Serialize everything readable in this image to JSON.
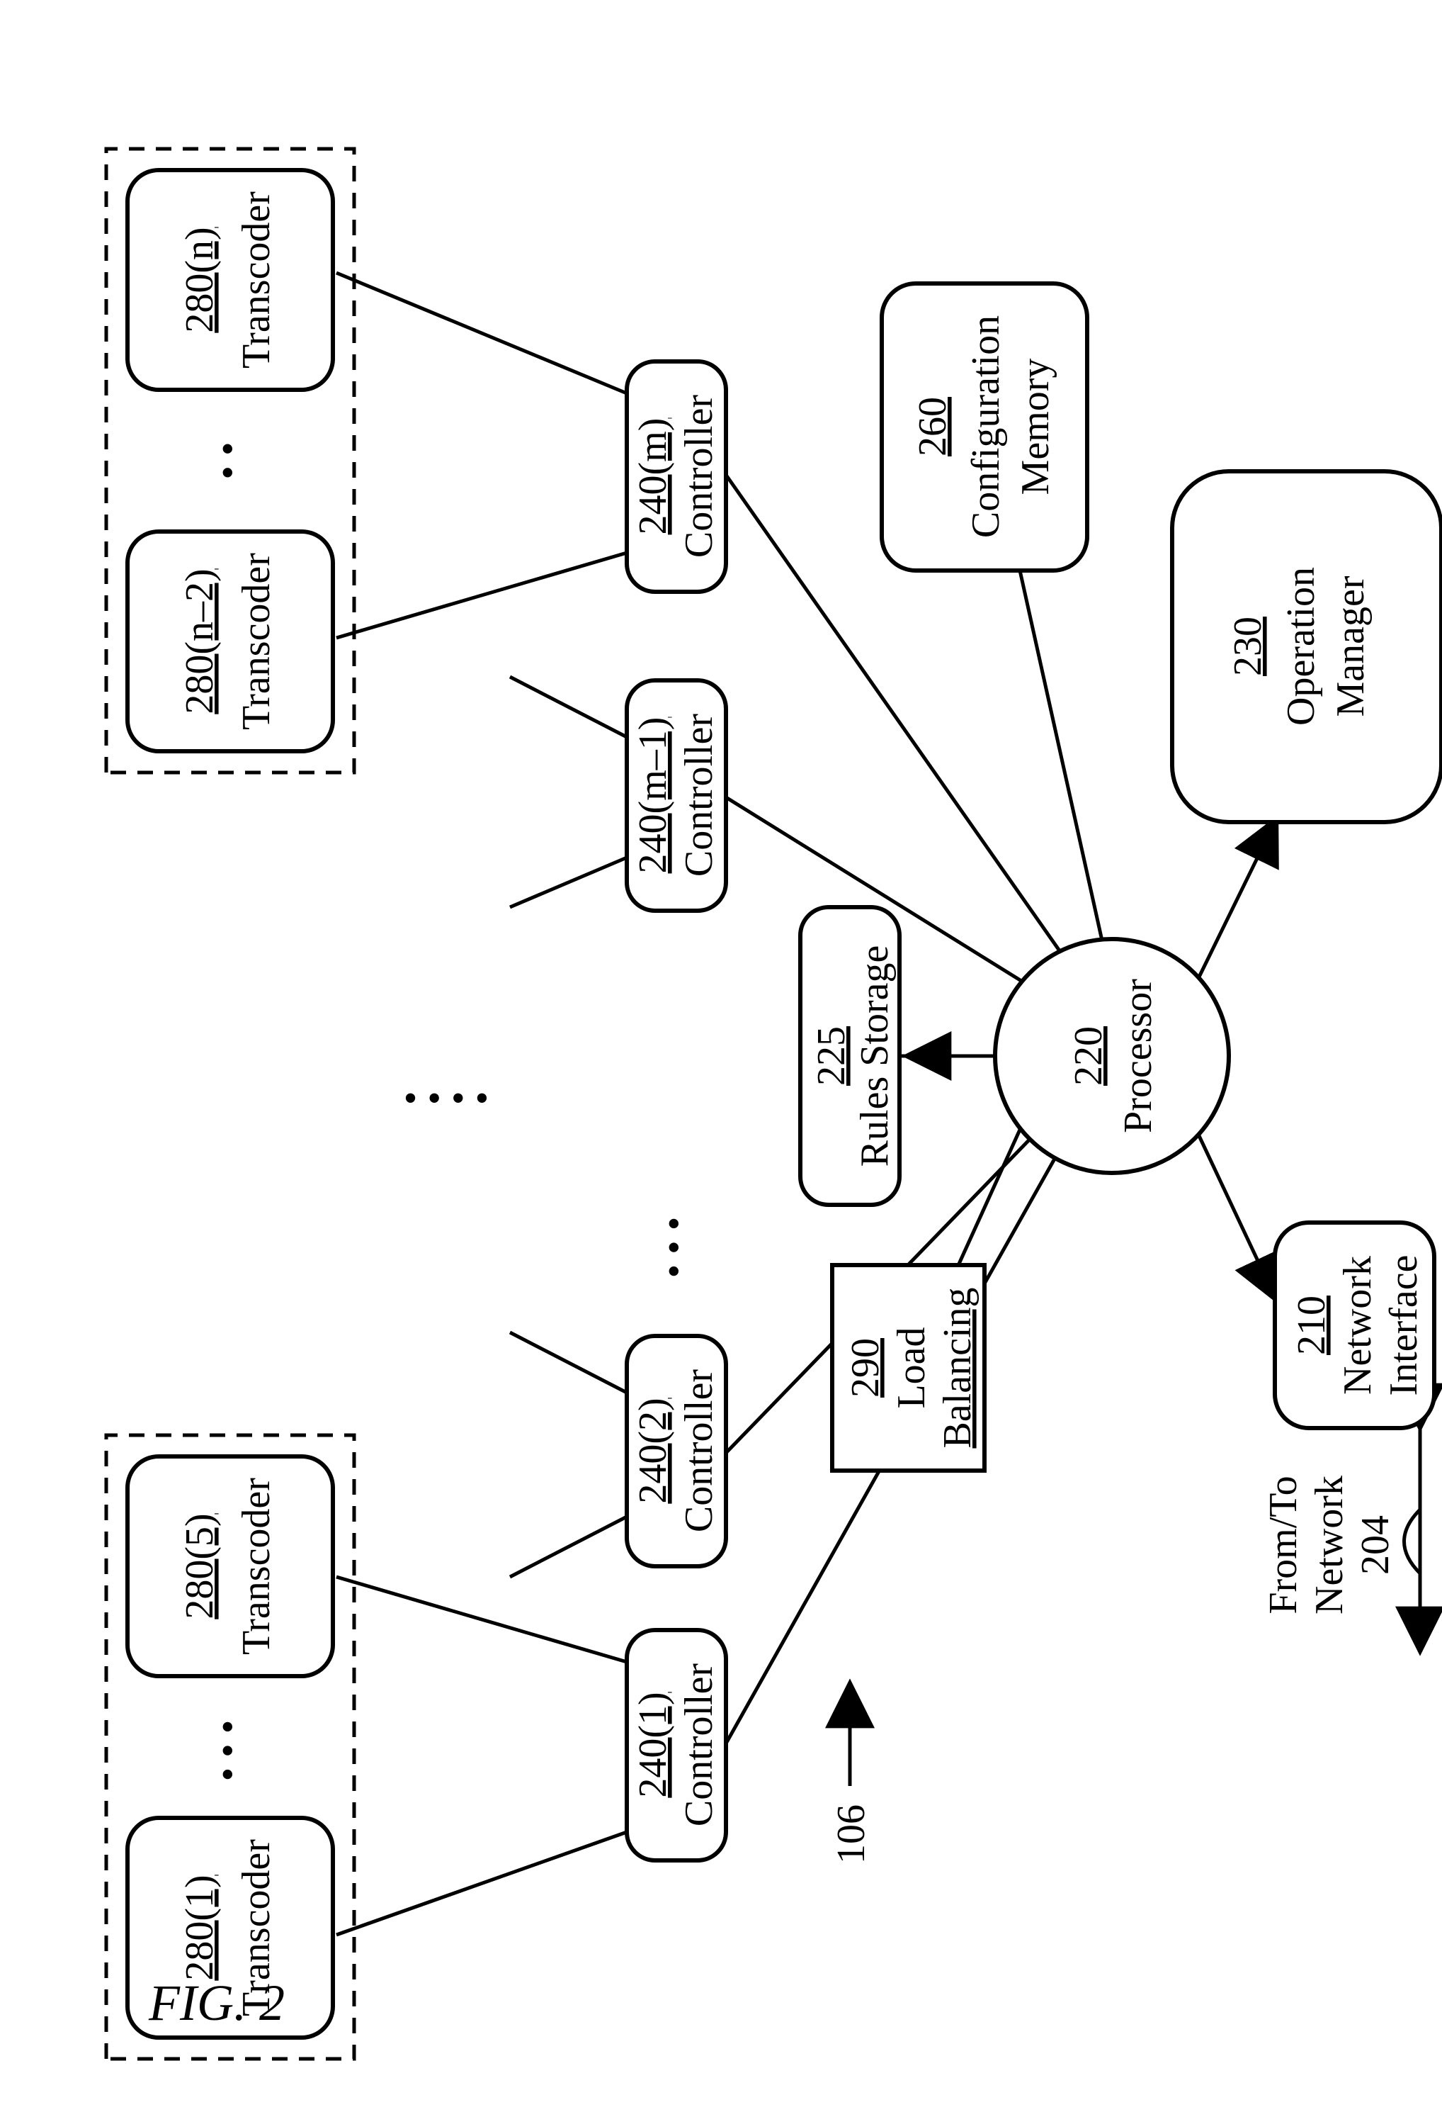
{
  "figure_label": "FIG. 2",
  "system_ref": "106",
  "network_label_1": "From/To",
  "network_label_2": "Network",
  "network_ref": "204",
  "nodes": {
    "processor": {
      "ref": "220",
      "label": "Processor"
    },
    "rules": {
      "ref": "225",
      "label": "Rules Storage"
    },
    "load": {
      "ref": "290",
      "label1": "Load",
      "label2": "Balancing"
    },
    "net_if": {
      "ref": "210",
      "label1": "Network",
      "label2": "Interface"
    },
    "op_mgr": {
      "ref": "230",
      "label1": "Operation",
      "label2": "Manager"
    },
    "cfg": {
      "ref": "260",
      "label1": "Configuration",
      "label2": "Memory"
    },
    "ctrl1": {
      "ref": "240(1)",
      "label": "Controller"
    },
    "ctrl2": {
      "ref": "240(2)",
      "label": "Controller"
    },
    "ctrlm1": {
      "ref": "240(m–1)",
      "label": "Controller"
    },
    "ctrlm": {
      "ref": "240(m)",
      "label": "Controller"
    },
    "t1": {
      "ref": "280(1)",
      "label": "Transcoder"
    },
    "t5": {
      "ref": "280(5)",
      "label": "Transcoder"
    },
    "tn2": {
      "ref": "280(n–2)",
      "label": "Transcoder"
    },
    "tn": {
      "ref": "280(n)",
      "label": "Transcoder"
    }
  },
  "dots": "• •",
  "dots4": "• • • •"
}
